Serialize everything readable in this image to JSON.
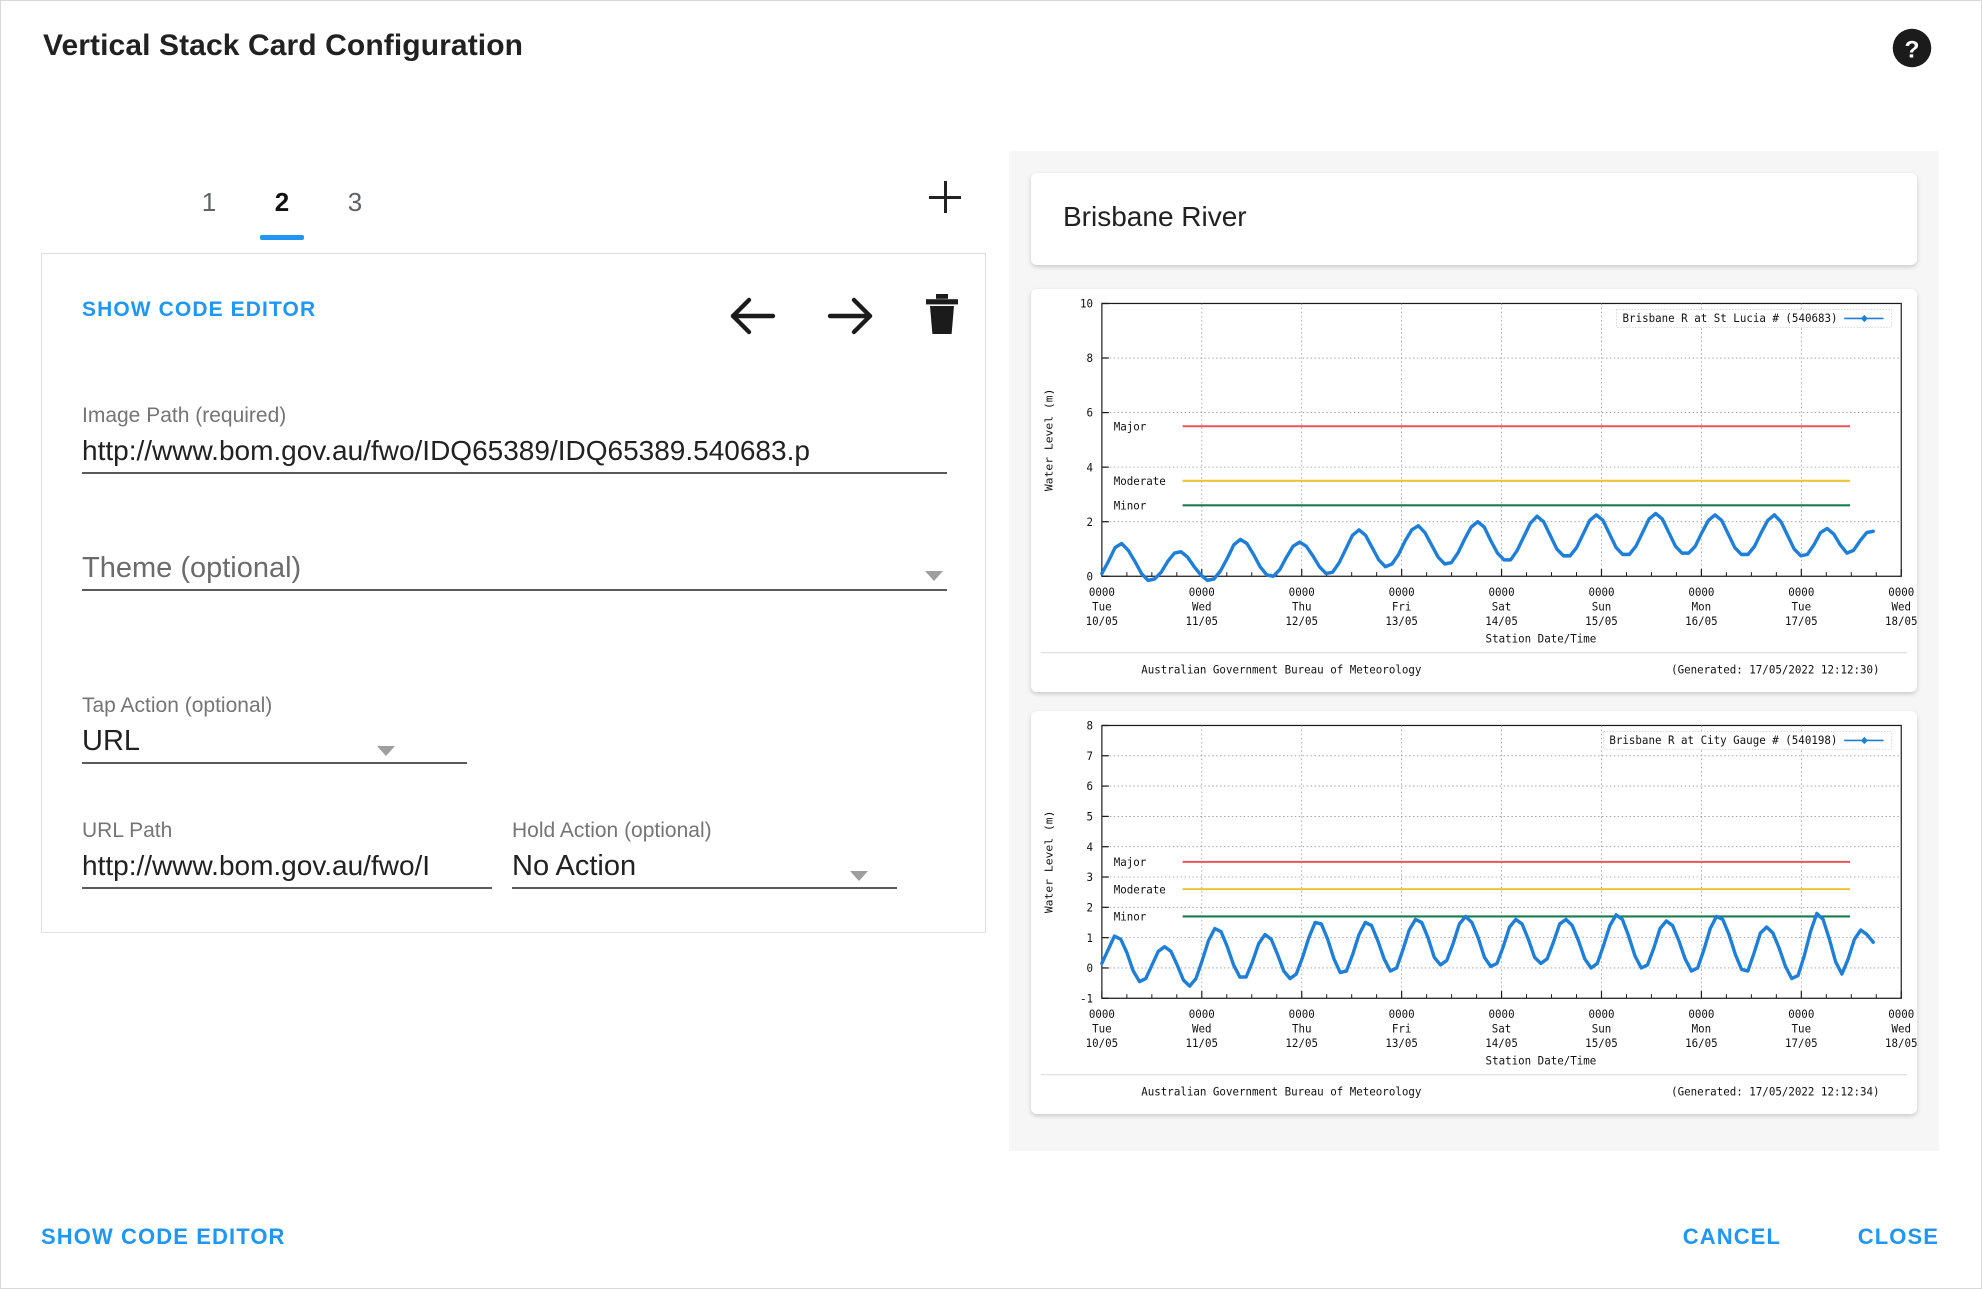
{
  "header": {
    "title": "Vertical Stack Card Configuration",
    "help_icon": "help-circle-icon"
  },
  "left_panel": {
    "tabs": [
      {
        "label": "1",
        "active": false
      },
      {
        "label": "2",
        "active": true
      },
      {
        "label": "3",
        "active": false
      }
    ],
    "add_tab_icon": "plus-icon",
    "toolbar": {
      "show_code_editor": "SHOW CODE EDITOR",
      "move_left_icon": "arrow-left-icon",
      "move_right_icon": "arrow-right-icon",
      "delete_icon": "trash-icon"
    },
    "fields": {
      "image_path": {
        "label": "Image Path (required)",
        "value": "http://www.bom.gov.au/fwo/IDQ65389/IDQ65389.540683.p"
      },
      "theme": {
        "label": "Theme (optional)",
        "value": "",
        "placeholder": "Theme (optional)"
      },
      "tap_action": {
        "label": "Tap Action (optional)",
        "value": "URL"
      },
      "url_path": {
        "label": "URL Path",
        "value": "http://www.bom.gov.au/fwo/I"
      },
      "hold_action": {
        "label": "Hold Action (optional)",
        "value": "No Action"
      }
    }
  },
  "footer": {
    "show_code_editor": "SHOW CODE EDITOR",
    "cancel": "CANCEL",
    "close": "CLOSE"
  },
  "preview": {
    "card_title": "Brisbane River"
  },
  "chart_data": [
    {
      "type": "line",
      "title": "",
      "legend": "Brisbane R at St Lucia # (540683)",
      "legend_position": "top-right",
      "xlabel": "Station Date/Time",
      "ylabel": "Water Level (m)",
      "ylim": [
        0,
        10
      ],
      "yticks": [
        0,
        2,
        4,
        6,
        8,
        10
      ],
      "xticklabels": [
        "0000\nTue\n10/05",
        "0000\nWed\n11/05",
        "0000\nThu\n12/05",
        "0000\nFri\n13/05",
        "0000\nSat\n14/05",
        "0000\nSun\n15/05",
        "0000\nMon\n16/05",
        "0000\nTue\n17/05",
        "0000\nWed\n18/05"
      ],
      "xtick_times": [
        "0000",
        "0000",
        "0000",
        "0000",
        "0000",
        "0000",
        "0000",
        "0000",
        "0000"
      ],
      "xtick_days": [
        "Tue",
        "Wed",
        "Thu",
        "Fri",
        "Sat",
        "Sun",
        "Mon",
        "Tue",
        "Wed"
      ],
      "xtick_dates": [
        "10/05",
        "11/05",
        "12/05",
        "13/05",
        "14/05",
        "15/05",
        "16/05",
        "17/05",
        "18/05"
      ],
      "grid": true,
      "thresholds": [
        {
          "name": "Major",
          "value": 5.5,
          "color": "#e8555a"
        },
        {
          "name": "Moderate",
          "value": 3.5,
          "color": "#eec23c"
        },
        {
          "name": "Minor",
          "value": 2.6,
          "color": "#1c7a4f"
        }
      ],
      "series_color": "#1f7fd8",
      "footer_left": "Australian Government Bureau of Meteorology",
      "footer_right": "(Generated: 17/05/2022 12:12:30)",
      "values": [
        0.1,
        0.55,
        1.05,
        1.2,
        0.95,
        0.55,
        0.1,
        -0.15,
        -0.1,
        0.15,
        0.55,
        0.85,
        0.9,
        0.7,
        0.35,
        0.05,
        -0.15,
        -0.1,
        0.2,
        0.65,
        1.15,
        1.35,
        1.2,
        0.8,
        0.35,
        0.05,
        0.0,
        0.25,
        0.7,
        1.1,
        1.25,
        1.1,
        0.75,
        0.35,
        0.1,
        0.15,
        0.5,
        1.0,
        1.5,
        1.7,
        1.5,
        1.05,
        0.6,
        0.35,
        0.45,
        0.8,
        1.3,
        1.7,
        1.85,
        1.6,
        1.15,
        0.7,
        0.45,
        0.5,
        0.85,
        1.35,
        1.8,
        2.0,
        1.8,
        1.3,
        0.85,
        0.6,
        0.6,
        0.95,
        1.45,
        1.95,
        2.2,
        2.0,
        1.5,
        1.0,
        0.75,
        0.75,
        1.05,
        1.55,
        2.05,
        2.25,
        2.05,
        1.55,
        1.05,
        0.8,
        0.8,
        1.1,
        1.6,
        2.1,
        2.3,
        2.1,
        1.6,
        1.1,
        0.85,
        0.85,
        1.1,
        1.6,
        2.05,
        2.25,
        2.05,
        1.55,
        1.05,
        0.8,
        0.8,
        1.1,
        1.6,
        2.05,
        2.25,
        2.0,
        1.5,
        1.0,
        0.75,
        0.8,
        1.15,
        1.6,
        1.75,
        1.55,
        1.15,
        0.85,
        0.95,
        1.3,
        1.6,
        1.65
      ]
    },
    {
      "type": "line",
      "title": "",
      "legend": "Brisbane R at City Gauge # (540198)",
      "legend_position": "top-right",
      "xlabel": "Station Date/Time",
      "ylabel": "Water Level (m)",
      "ylim": [
        -1,
        8
      ],
      "yticks": [
        -1,
        0,
        1,
        2,
        3,
        4,
        5,
        6,
        7,
        8
      ],
      "xticklabels": [
        "0000\nTue\n10/05",
        "0000\nWed\n11/05",
        "0000\nThu\n12/05",
        "0000\nFri\n13/05",
        "0000\nSat\n14/05",
        "0000\nSun\n15/05",
        "0000\nMon\n16/05",
        "0000\nTue\n17/05",
        "0000\nWed\n18/05"
      ],
      "xtick_times": [
        "0000",
        "0000",
        "0000",
        "0000",
        "0000",
        "0000",
        "0000",
        "0000",
        "0000"
      ],
      "xtick_days": [
        "Tue",
        "Wed",
        "Thu",
        "Fri",
        "Sat",
        "Sun",
        "Mon",
        "Tue",
        "Wed"
      ],
      "xtick_dates": [
        "10/05",
        "11/05",
        "12/05",
        "13/05",
        "14/05",
        "15/05",
        "16/05",
        "17/05",
        "18/05"
      ],
      "grid": true,
      "thresholds": [
        {
          "name": "Major",
          "value": 3.5,
          "color": "#e8555a"
        },
        {
          "name": "Moderate",
          "value": 2.6,
          "color": "#eec23c"
        },
        {
          "name": "Minor",
          "value": 1.7,
          "color": "#1c7a4f"
        }
      ],
      "series_color": "#1f7fd8",
      "footer_left": "Australian Government Bureau of Meteorology",
      "footer_right": "(Generated: 17/05/2022 12:12:34)",
      "values": [
        0.15,
        0.6,
        1.05,
        0.95,
        0.5,
        -0.1,
        -0.45,
        -0.35,
        0.1,
        0.55,
        0.7,
        0.55,
        0.1,
        -0.4,
        -0.6,
        -0.35,
        0.25,
        0.9,
        1.3,
        1.2,
        0.7,
        0.1,
        -0.3,
        -0.3,
        0.2,
        0.8,
        1.1,
        0.95,
        0.45,
        -0.1,
        -0.35,
        -0.2,
        0.35,
        1.0,
        1.5,
        1.45,
        0.95,
        0.3,
        -0.15,
        -0.1,
        0.45,
        1.1,
        1.5,
        1.4,
        0.9,
        0.3,
        -0.1,
        0.0,
        0.6,
        1.25,
        1.6,
        1.5,
        1.0,
        0.35,
        0.1,
        0.25,
        0.8,
        1.45,
        1.7,
        1.5,
        1.0,
        0.35,
        0.05,
        0.15,
        0.7,
        1.35,
        1.6,
        1.45,
        0.95,
        0.35,
        0.15,
        0.3,
        0.85,
        1.45,
        1.6,
        1.4,
        0.9,
        0.3,
        0.0,
        0.15,
        0.75,
        1.4,
        1.75,
        1.6,
        1.05,
        0.4,
        0.0,
        0.1,
        0.65,
        1.3,
        1.55,
        1.4,
        0.9,
        0.3,
        -0.1,
        0.0,
        0.6,
        1.3,
        1.7,
        1.6,
        1.1,
        0.45,
        -0.05,
        -0.1,
        0.5,
        1.15,
        1.35,
        1.15,
        0.65,
        0.05,
        -0.35,
        -0.25,
        0.4,
        1.2,
        1.8,
        1.6,
        0.95,
        0.2,
        -0.2,
        0.3,
        0.95,
        1.25,
        1.1,
        0.85
      ]
    }
  ]
}
